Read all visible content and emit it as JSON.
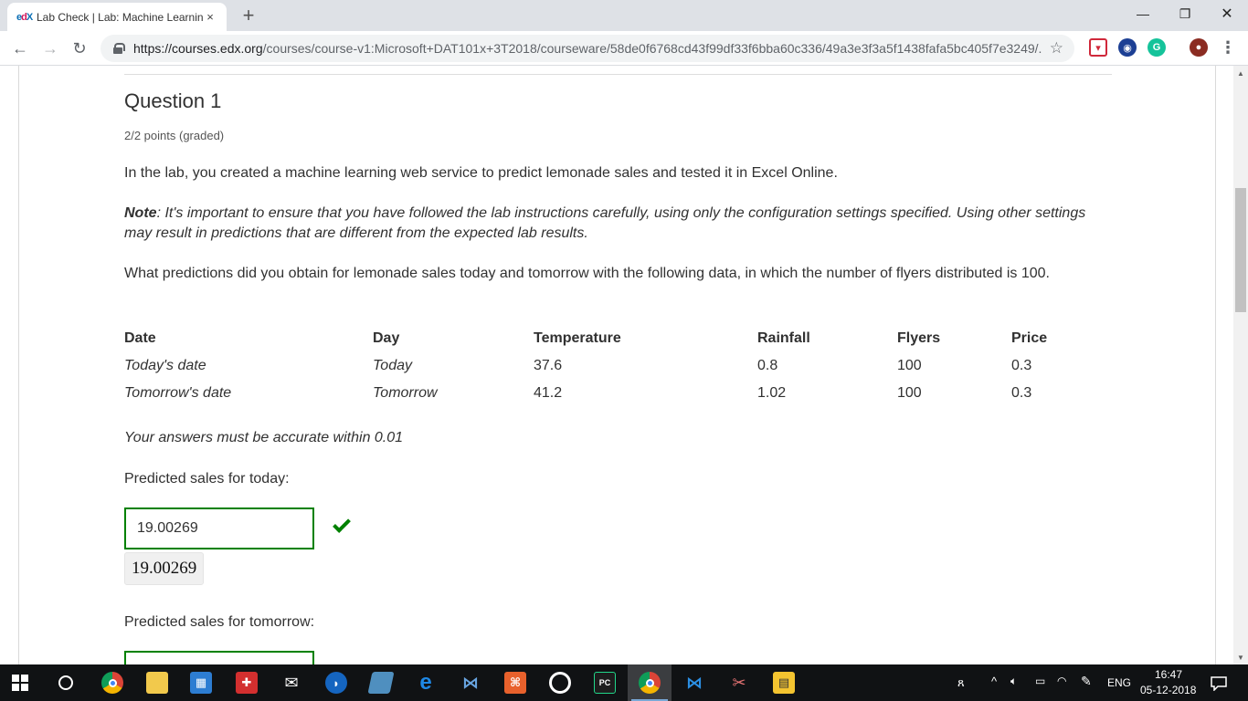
{
  "browser": {
    "tab_favicon": "edX",
    "tab_title": "Lab Check | Lab: Machine Learnin",
    "tab_close": "×",
    "new_tab": "+",
    "minimize": "—",
    "restore": "❐",
    "close": "✕",
    "url_host": "https://courses.edx.org",
    "url_path": "/courses/course-v1:Microsoft+DAT101x+3T2018/courseware/58de0f6768cd43f99df33f6bba60c336/49a3e3f3a5f1438fafa5bc405f7e3249/...",
    "back": "←",
    "forward": "→",
    "reload": "↻",
    "bookmark_star": "☆",
    "menu": "⋮"
  },
  "question": {
    "title": "Question 1",
    "points": "2/2 points (graded)",
    "intro": "In the lab, you created a machine learning web service to predict lemonade sales and tested it in Excel Online.",
    "note_label": "Note",
    "note_text": ": It's important to ensure that you have followed the lab instructions carefully, using only the configuration settings specified. Using other settings may result in predictions that are different from the expected lab results.",
    "prompt": "What predictions did you obtain for lemonade sales today and tomorrow with the following data, in which the number of flyers distributed is 100.",
    "table": {
      "headers": [
        "Date",
        "Day",
        "Temperature",
        "Rainfall",
        "Flyers",
        "Price"
      ],
      "rows": [
        [
          "Today's date",
          "Today",
          "37.6",
          "0.8",
          "100",
          "0.3"
        ],
        [
          "Tomorrow's date",
          "Tomorrow",
          "41.2",
          "1.02",
          "100",
          "0.3"
        ]
      ]
    },
    "accuracy_note": "Your answers must be accurate within 0.01",
    "today_label": "Predicted sales for today:",
    "today_value": "19.00269",
    "today_preview": "19.00269",
    "tomorrow_label": "Predicted sales for tomorrow:",
    "tomorrow_value": ""
  },
  "taskbar": {
    "language": "ENG",
    "time": "16:47",
    "date": "05-12-2018"
  },
  "colors": {
    "correct_green": "#008100",
    "tab_strip": "#dee1e6",
    "taskbar": "#101214"
  }
}
